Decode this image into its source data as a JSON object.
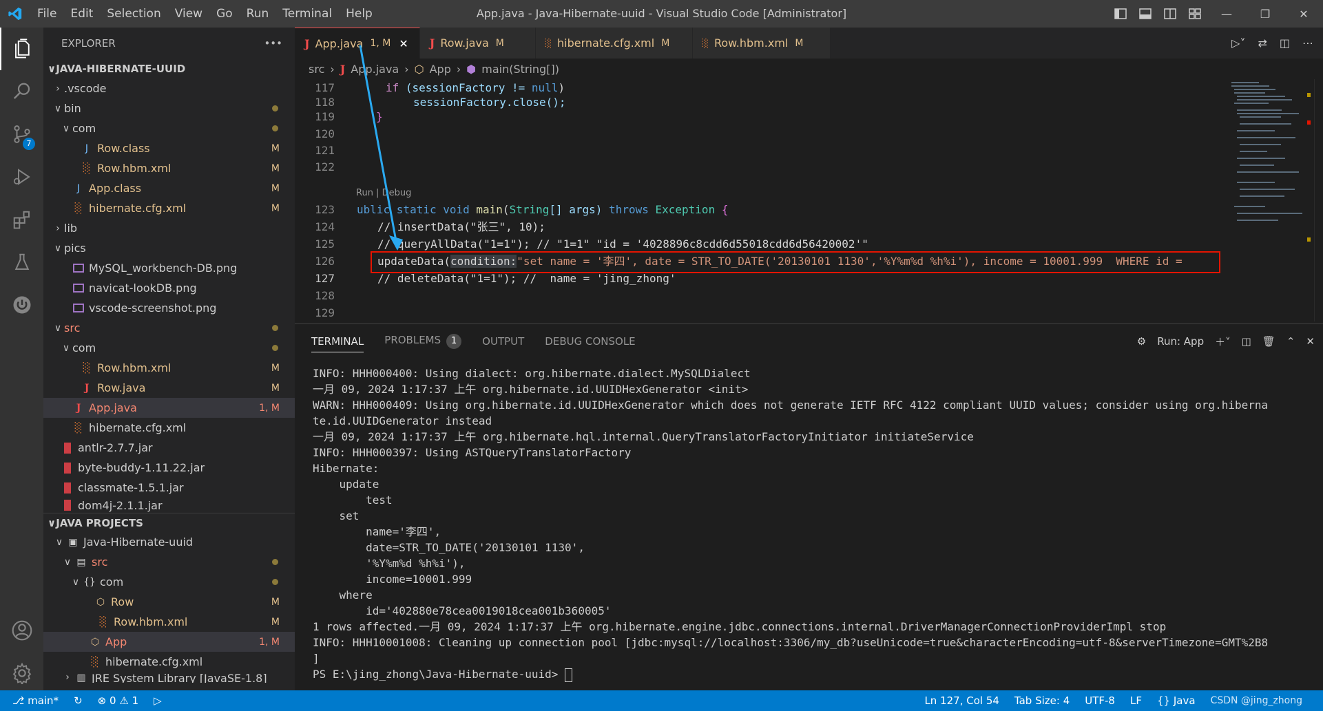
{
  "window": {
    "title": "App.java - Java-Hibernate-uuid - Visual Studio Code [Administrator]",
    "menu": [
      "File",
      "Edit",
      "Selection",
      "View",
      "Go",
      "Run",
      "Terminal",
      "Help"
    ]
  },
  "activity": {
    "scm_badge": "7"
  },
  "explorer": {
    "header": "EXPLORER",
    "project_section": "JAVA-HIBERNATE-UUID",
    "items": [
      {
        "label": ".vscode"
      },
      {
        "label": "bin"
      },
      {
        "label": "com"
      },
      {
        "label": "Row.class",
        "status": "M"
      },
      {
        "label": "Row.hbm.xml",
        "status": "M"
      },
      {
        "label": "App.class",
        "status": "M"
      },
      {
        "label": "hibernate.cfg.xml",
        "status": "M"
      },
      {
        "label": "lib"
      },
      {
        "label": "pics"
      },
      {
        "label": "MySQL_workbench-DB.png"
      },
      {
        "label": "navicat-lookDB.png"
      },
      {
        "label": "vscode-screenshot.png"
      },
      {
        "label": "src"
      },
      {
        "label": "com"
      },
      {
        "label": "Row.hbm.xml",
        "status": "M"
      },
      {
        "label": "Row.java",
        "status": "M"
      },
      {
        "label": "App.java",
        "status": "1, M"
      },
      {
        "label": "hibernate.cfg.xml"
      },
      {
        "label": "antlr-2.7.7.jar"
      },
      {
        "label": "byte-buddy-1.11.22.jar"
      },
      {
        "label": "classmate-1.5.1.jar"
      },
      {
        "label": "dom4j-2.1.1.jar"
      }
    ],
    "java_section": "JAVA PROJECTS",
    "java_items": [
      {
        "label": "Java-Hibernate-uuid"
      },
      {
        "label": "src"
      },
      {
        "label": "com"
      },
      {
        "label": "Row",
        "status": "M"
      },
      {
        "label": "Row.hbm.xml",
        "status": "M"
      },
      {
        "label": "App",
        "status": "1, M"
      },
      {
        "label": "hibernate.cfg.xml"
      },
      {
        "label": "JRE System Library [JavaSE-1.8]"
      }
    ]
  },
  "tabs": [
    {
      "label": "App.java",
      "status": "1, M"
    },
    {
      "label": "Row.java",
      "status": "M"
    },
    {
      "label": "hibernate.cfg.xml",
      "status": "M"
    },
    {
      "label": "Row.hbm.xml",
      "status": "M"
    }
  ],
  "breadcrumb": [
    "src",
    "App.java",
    "App",
    "main(String[])"
  ],
  "code": {
    "ln117": "117",
    "ln118": "118",
    "ln119": "119",
    "ln120": "120",
    "ln121": "121",
    "ln122": "122",
    "ln123": "123",
    "ln124": "124",
    "ln125": "125",
    "ln126": "126",
    "ln127": "127",
    "ln128": "128",
    "ln129": "129",
    "l117_kw": "if",
    "l117_a": " (sessionFactory != ",
    "l117_null": "null",
    "l117_b": ")",
    "l118": "sessionFactory.close();",
    "l119": "}",
    "codelens": "Run | Debug",
    "l123_kw1": "ublic static void ",
    "l123_fn": "main",
    "l123_a": "(",
    "l123_ty": "String",
    "l123_b": "[] args) ",
    "l123_kw2": "throws ",
    "l123_ty2": "Exception",
    "l123_c": " {",
    "l124": "// insertData(\"张三\", 10);",
    "l125": "// queryAllData(\"1=1\"); // \"1=1\" \"id = '4028896c8cdd6d55018cdd6d56420002'\"",
    "l126_fn": "updateData",
    "l126_a": "(",
    "l126_hint": "condition:",
    "l126_str": "\"set name = '李四', date = STR_TO_DATE('20130101 1130','%Y%m%d %h%i'), income = 10001.999  WHERE id =",
    "l127": "// deleteData(\"1=1\"); //  name = 'jing_zhong'"
  },
  "panel": {
    "tabs": [
      "TERMINAL",
      "PROBLEMS",
      "OUTPUT",
      "DEBUG CONSOLE"
    ],
    "problems_count": "1",
    "run_label": "Run: App",
    "terminal_lines": [
      "INFO: HHH000400: Using dialect: org.hibernate.dialect.MySQLDialect",
      "一月 09, 2024 1:17:37 上午 org.hibernate.id.UUIDHexGenerator <init>",
      "WARN: HHH000409: Using org.hibernate.id.UUIDHexGenerator which does not generate IETF RFC 4122 compliant UUID values; consider using org.hiberna",
      "te.id.UUIDGenerator instead",
      "一月 09, 2024 1:17:37 上午 org.hibernate.hql.internal.QueryTranslatorFactoryInitiator initiateService",
      "INFO: HHH000397: Using ASTQueryTranslatorFactory",
      "Hibernate:",
      "    update",
      "        test",
      "    set",
      "        name='李四',",
      "        date=STR_TO_DATE('20130101 1130',",
      "        '%Y%m%d %h%i'),",
      "        income=10001.999",
      "    where",
      "        id='402880e78cea0019018cea001b360005'",
      "1 rows affected.一月 09, 2024 1:17:37 上午 org.hibernate.engine.jdbc.connections.internal.DriverManagerConnectionProviderImpl stop",
      "INFO: HHH10001008: Cleaning up connection pool [jdbc:mysql://localhost:3306/my_db?useUnicode=true&characterEncoding=utf-8&serverTimezone=GMT%2B8",
      "]"
    ],
    "prompt": "PS E:\\jing_zhong\\Java-Hibernate-uuid> "
  },
  "status": {
    "branch": "main*",
    "errors": "0",
    "warnings": "1",
    "position": "Ln 127, Col 54",
    "tab_size": "Tab Size: 4",
    "encoding": "UTF-8",
    "eol": "LF",
    "language": "Java",
    "watermark": "CSDN @jing_zhong"
  }
}
